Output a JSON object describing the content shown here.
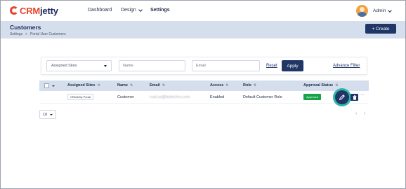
{
  "app": {
    "logo_crm": "CRM",
    "logo_jetty": "jetty"
  },
  "nav": {
    "dashboard": "Dashboard",
    "design": "Design",
    "settings": "Settings",
    "user": "Admin"
  },
  "header": {
    "title": "Customers",
    "breadcrumb": [
      "Settings",
      ">",
      "Portal User Customers"
    ],
    "create_label": "+ Create"
  },
  "filters": {
    "assigned_sites_placeholder": "Assigned Sites",
    "name_placeholder": "Name",
    "email_placeholder": "Email",
    "reset_label": "Reset",
    "apply_label": "Apply",
    "advance_filter_label": "Advance Filter"
  },
  "table": {
    "columns": [
      "Assigned Sites",
      "Name",
      "Email",
      "Access",
      "Role",
      "Approval Status"
    ],
    "sort_glyph": "⇅",
    "rows": [
      {
        "assigned_site": "CRMJetty Portal",
        "name": "Customer",
        "email": "cust.xx@biztechcs.com",
        "access": "Enabled",
        "role": "Default Customer Role",
        "approval_status": "Approved"
      }
    ],
    "more_glyph": "···"
  },
  "footer": {
    "page_size": "10",
    "prev": "‹",
    "next": "›"
  },
  "colors": {
    "brand_red": "#e8442c",
    "brand_navy": "#1f3666",
    "header_band": "#d4deec",
    "approved_green": "#16a34a",
    "highlight_teal": "#2fb7a9"
  }
}
